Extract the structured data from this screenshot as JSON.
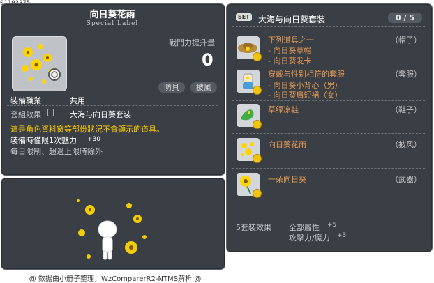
{
  "item_id": "01103375",
  "item": {
    "name": "向日葵花雨",
    "label": "Special Label",
    "power_label": "戰鬥力提升量",
    "power_value": "0",
    "tags": [
      "防具",
      "披風"
    ],
    "job_label": "裝備職業",
    "job_value": "共用",
    "set_label": "套組效果",
    "set_value": "大海与向日葵套装",
    "warning": "這是角色資料窗等部份狀況不會顯示的道具。",
    "equip_limit": "裝備時僅限1次魅力",
    "equip_limit_bonus": "+30",
    "limit_note": "每日限制、超過上限時除外"
  },
  "set_panel": {
    "badge": "SET",
    "title": "大海与向日葵套装",
    "count": "0 / 5",
    "items": [
      {
        "title": "下列道具之一",
        "subs": [
          "- 向日葵草帽",
          "- 向日葵发卡"
        ],
        "category": "（帽子）",
        "icon": "hat-icon"
      },
      {
        "title": "穿戴与性别相符的套服",
        "subs": [
          "- 向日葵小背心（男）",
          "- 向日葵肩短裙（女）"
        ],
        "category": "（套服）",
        "icon": "outfit-icon"
      },
      {
        "title": "草绿凉鞋",
        "subs": [],
        "category": "（鞋子）",
        "icon": "sandal-icon"
      },
      {
        "title": "向日葵花雨",
        "subs": [],
        "category": "（披风）",
        "icon": "flower-rain-icon"
      },
      {
        "title": "一朵向日葵",
        "subs": [],
        "category": "（武器）",
        "icon": "sunflower-icon"
      }
    ],
    "effect_label": "5套裝效果",
    "effect_1": "全部屬性",
    "effect_1_value": "+5",
    "effect_2": "攻擊力/魔力",
    "effect_2_value": "+3"
  },
  "footer": "@ 数据由小册子整理，WzComparerR2-NTMS解析 @",
  "colors": {
    "panel": "#3a3f45",
    "warning": "#ffcc00",
    "category": "#c8c8c8"
  }
}
